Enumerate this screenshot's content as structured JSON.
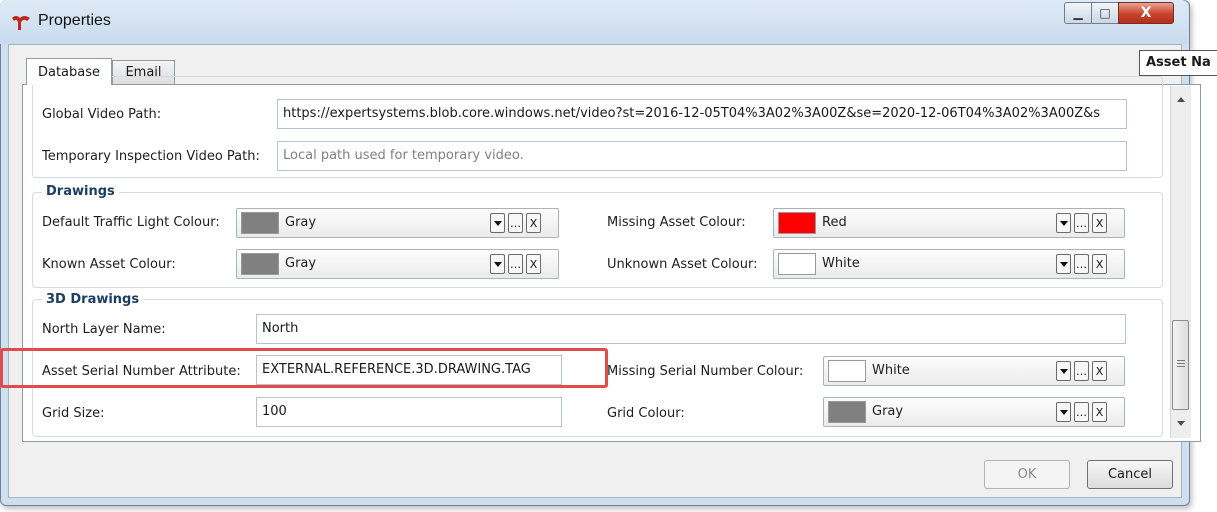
{
  "window": {
    "title": "Properties",
    "minimize_glyph": "▁",
    "maximize_glyph": "□",
    "close_glyph": "X"
  },
  "tabs": [
    {
      "label": "Database",
      "active": true
    },
    {
      "label": "Email",
      "active": false
    }
  ],
  "tooltip": "Asset Na",
  "video": {
    "global_video_path": {
      "label": "Global Video Path:",
      "value": "https://expertsystems.blob.core.windows.net/video?st=2016-12-05T04%3A02%3A00Z&se=2020-12-06T04%3A02%3A00Z&s"
    },
    "temp_video_path": {
      "label": "Temporary Inspection Video Path:",
      "value": "",
      "placeholder": "Local path used for temporary video."
    }
  },
  "drawings": {
    "title": "Drawings",
    "default_traffic_light": {
      "label": "Default Traffic Light Colour:",
      "color_name": "Gray",
      "color": "#808080"
    },
    "known_asset": {
      "label": "Known Asset Colour:",
      "color_name": "Gray",
      "color": "#808080"
    },
    "missing_asset": {
      "label": "Missing Asset Colour:",
      "color_name": "Red",
      "color": "#ff0000"
    },
    "unknown_asset": {
      "label": "Unknown Asset Colour:",
      "color_name": "White",
      "color": "#ffffff"
    }
  },
  "drawings3d": {
    "title": "3D Drawings",
    "north_layer": {
      "label": "North Layer Name:",
      "value": "North"
    },
    "serial_attr": {
      "label": "Asset Serial Number Attribute:",
      "value": "EXTERNAL.REFERENCE.3D.DRAWING.TAG"
    },
    "grid_size": {
      "label": "Grid Size:",
      "value": "100"
    },
    "missing_serial": {
      "label": "Missing Serial Number Colour:",
      "color_name": "White",
      "color": "#ffffff"
    },
    "grid_colour": {
      "label": "Grid Colour:",
      "color_name": "Gray",
      "color": "#808080"
    }
  },
  "picker_buttons": {
    "more": "…",
    "clear": "X"
  },
  "buttons": {
    "ok": "OK",
    "cancel": "Cancel"
  },
  "colors": {
    "highlight": "#e24b4b",
    "group_title": "#1a3e66"
  }
}
